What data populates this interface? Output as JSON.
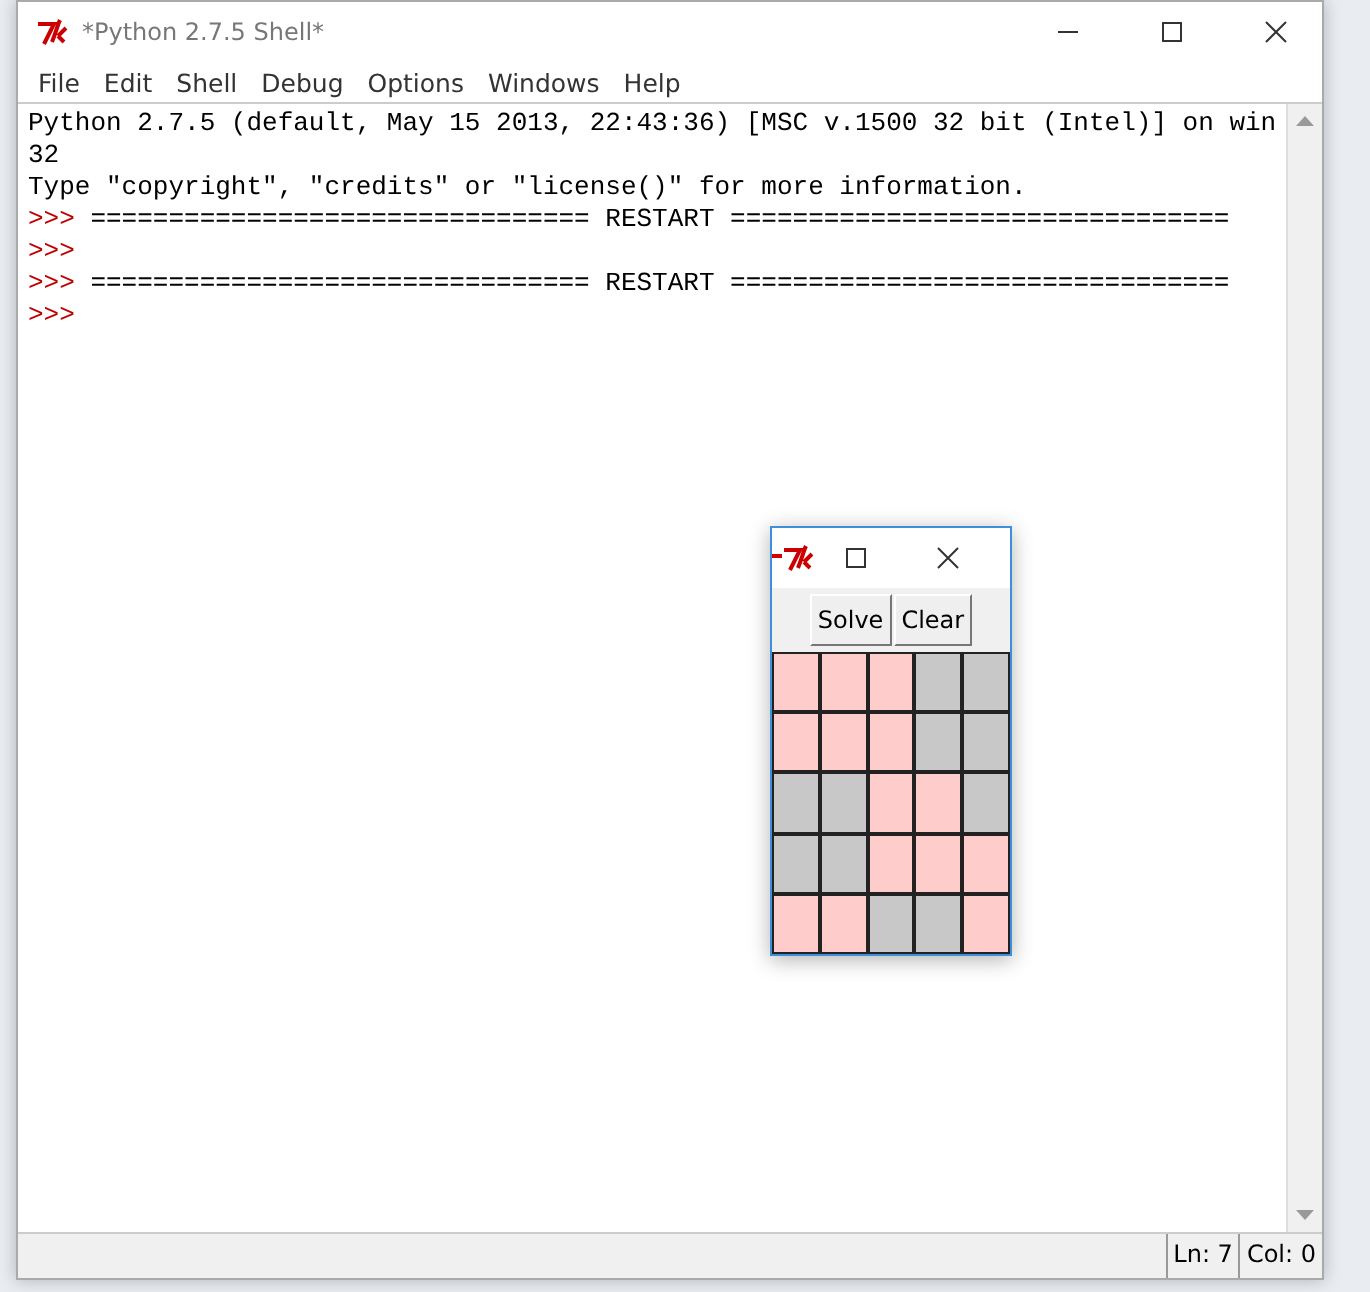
{
  "window": {
    "title": "*Python 2.7.5 Shell*"
  },
  "menu": [
    "File",
    "Edit",
    "Shell",
    "Debug",
    "Options",
    "Windows",
    "Help"
  ],
  "shell_lines": [
    {
      "text": "Python 2.7.5 (default, May 15 2013, 22:43:36) [MSC v.1500 32 bit (Intel)] on win"
    },
    {
      "text": "32"
    },
    {
      "text": "Type \"copyright\", \"credits\" or \"license()\" for more information."
    },
    {
      "prompt": ">>>",
      "text": " ================================ RESTART ================================"
    },
    {
      "prompt": ">>>"
    },
    {
      "prompt": ">>>",
      "text": " ================================ RESTART ================================"
    },
    {
      "prompt": ">>>"
    }
  ],
  "status_bar": {
    "line": "Ln: 7",
    "column": "Col: 0"
  },
  "dialog": {
    "buttons": [
      "Solve",
      "Clear"
    ],
    "grid": [
      [
        {
          "on": true
        },
        {
          "on": true
        },
        {
          "on": true
        },
        {
          "on": false
        },
        {
          "on": false
        }
      ],
      [
        {
          "on": true
        },
        {
          "on": true
        },
        {
          "on": true
        },
        {
          "on": false
        },
        {
          "on": false
        }
      ],
      [
        {
          "on": false
        },
        {
          "on": false
        },
        {
          "on": true
        },
        {
          "on": true
        },
        {
          "on": false
        }
      ],
      [
        {
          "on": false
        },
        {
          "on": false
        },
        {
          "on": true
        },
        {
          "on": true
        },
        {
          "on": true
        }
      ],
      [
        {
          "on": true
        },
        {
          "on": true
        },
        {
          "on": false
        },
        {
          "on": false
        },
        {
          "on": true
        }
      ]
    ]
  }
}
